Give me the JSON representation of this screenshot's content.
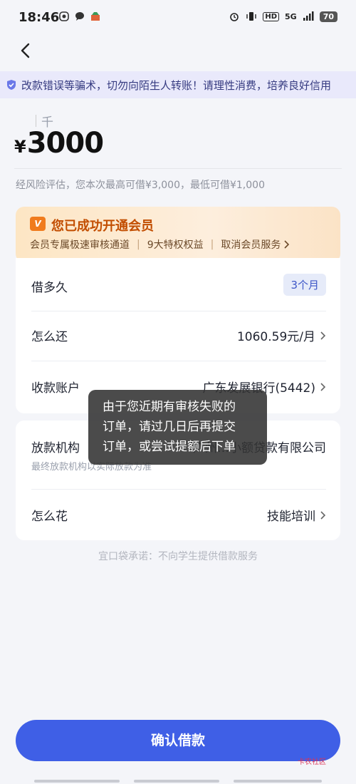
{
  "status_bar": {
    "time": "18:46",
    "network": "5G",
    "hd": "HD",
    "battery": "70"
  },
  "notice": {
    "text": "改款错误等骗术，切勿向陌生人转账！请理性消费，培养良好信用"
  },
  "loan": {
    "unit": "千",
    "currency": "¥",
    "amount": "3000",
    "risk_text": "经风险评估，您本次最高可借¥3,000，最低可借¥1,000"
  },
  "vip": {
    "badge": "Vip",
    "title": "您已成功开通会员",
    "benefit_1": "会员专属极速审核通道",
    "benefit_2": "9大特权权益",
    "cancel": "取消会员服务"
  },
  "rows": {
    "term_label": "借多久",
    "term_value": "3个月",
    "repay_label": "怎么还",
    "repay_value": "1060.59元/月",
    "account_label": "收款账户",
    "account_value": "广东发展银行(5442)",
    "lender_label": "放款机构",
    "lender_value": "广州…小额贷款有限公司",
    "lender_note": "最终放款机构以实际放款为准",
    "usage_label": "怎么花",
    "usage_value": "技能培训"
  },
  "promise": "宜口袋承诺：不向学生提供借款服务",
  "toast": "由于您近期有审核失败的\n订单，请过几日后再提交\n订单，或尝试提额后下单",
  "confirm_button": "确认借款",
  "watermark": "卡农社区",
  "colors": {
    "primary": "#3f5fe6",
    "vip_orange": "#c24d00",
    "notice_bg": "#e9e9fb"
  }
}
